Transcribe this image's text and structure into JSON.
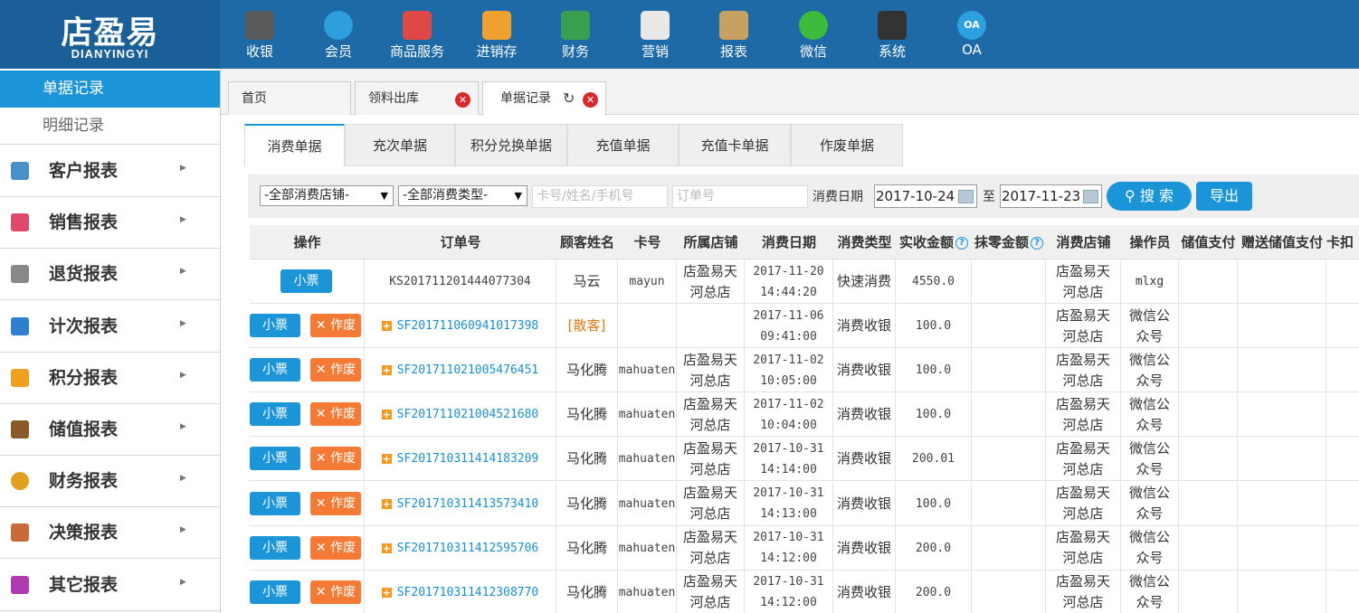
{
  "brand": {
    "name_cn": "店盈易",
    "name_en": "DIANYINGYI"
  },
  "topnav": [
    {
      "label": "收银",
      "icon": "cash-register-icon",
      "color": "#5a5a5a"
    },
    {
      "label": "会员",
      "icon": "member-icon",
      "color": "#2e9fdc"
    },
    {
      "label": "商品服务",
      "icon": "goods-icon",
      "color": "#e04848"
    },
    {
      "label": "进销存",
      "icon": "inventory-icon",
      "color": "#f0a030"
    },
    {
      "label": "财务",
      "icon": "finance-icon",
      "color": "#3aa050"
    },
    {
      "label": "营销",
      "icon": "megaphone-icon",
      "color": "#e8e8e8"
    },
    {
      "label": "报表",
      "icon": "report-icon",
      "color": "#c8a060"
    },
    {
      "label": "微信",
      "icon": "wechat-icon",
      "color": "#3cbb3c"
    },
    {
      "label": "系统",
      "icon": "monitor-icon",
      "color": "#333333"
    },
    {
      "label": "OA",
      "icon": "oa-icon",
      "color": "#2ea0e0"
    }
  ],
  "sidebar": {
    "sub_items": [
      "单据记录",
      "明细记录"
    ],
    "items": [
      {
        "label": "客户报表",
        "icon": "customer-icon"
      },
      {
        "label": "销售报表",
        "icon": "sales-icon"
      },
      {
        "label": "退货报表",
        "icon": "return-icon"
      },
      {
        "label": "计次报表",
        "icon": "count-icon"
      },
      {
        "label": "积分报表",
        "icon": "points-icon"
      },
      {
        "label": "储值报表",
        "icon": "wallet-icon"
      },
      {
        "label": "财务报表",
        "icon": "coin-icon"
      },
      {
        "label": "决策报表",
        "icon": "decision-icon"
      },
      {
        "label": "其它报表",
        "icon": "folder-icon"
      }
    ]
  },
  "tabs": [
    {
      "label": "首页"
    },
    {
      "label": "领料出库"
    },
    {
      "label": "单据记录"
    }
  ],
  "subtabs": [
    "消费单据",
    "充次单据",
    "积分兑换单据",
    "充值单据",
    "充值卡单据",
    "作废单据"
  ],
  "filters": {
    "store_select": "-全部消费店铺-",
    "type_select": "-全部消费类型-",
    "member_placeholder": "卡号/姓名/手机号",
    "order_placeholder": "订单号",
    "date_label": "消费日期",
    "date_from": "2017-10-24",
    "to_label": "至",
    "date_to": "2017-11-23",
    "search_label": "搜 索",
    "export_label": "导出"
  },
  "table": {
    "columns": [
      "操作",
      "订单号",
      "顾客姓名",
      "卡号",
      "所属店铺",
      "消费日期",
      "消费类型",
      "实收金额",
      "抹零金额",
      "消费店铺",
      "操作员",
      "储值支付",
      "赠送储值支付",
      "卡扣"
    ],
    "ticket_label": "小票",
    "void_label": "作废",
    "rows": [
      {
        "order": "KS201711201444077304",
        "name": "马云",
        "card": "mayun",
        "store": "店盈易天河总店",
        "date": "2017-11-20",
        "time": "14:44:20",
        "type": "快速消费",
        "amount": "4550.0",
        "shop": "店盈易天河总店",
        "operator": "mlxg",
        "voidable": false
      },
      {
        "order": "SF201711060941017398",
        "name": "[散客]",
        "card": "",
        "store": "",
        "date": "2017-11-06",
        "time": "09:41:00",
        "type": "消费收银",
        "amount": "100.0",
        "shop": "店盈易天河总店",
        "operator": "微信公众号",
        "voidable": true
      },
      {
        "order": "SF201711021005476451",
        "name": "马化腾",
        "card": "mahuaten",
        "store": "店盈易天河总店",
        "date": "2017-11-02",
        "time": "10:05:00",
        "type": "消费收银",
        "amount": "100.0",
        "shop": "店盈易天河总店",
        "operator": "微信公众号",
        "voidable": true
      },
      {
        "order": "SF201711021004521680",
        "name": "马化腾",
        "card": "mahuaten",
        "store": "店盈易天河总店",
        "date": "2017-11-02",
        "time": "10:04:00",
        "type": "消费收银",
        "amount": "100.0",
        "shop": "店盈易天河总店",
        "operator": "微信公众号",
        "voidable": true
      },
      {
        "order": "SF201710311414183209",
        "name": "马化腾",
        "card": "mahuaten",
        "store": "店盈易天河总店",
        "date": "2017-10-31",
        "time": "14:14:00",
        "type": "消费收银",
        "amount": "200.01",
        "shop": "店盈易天河总店",
        "operator": "微信公众号",
        "voidable": true
      },
      {
        "order": "SF201710311413573410",
        "name": "马化腾",
        "card": "mahuaten",
        "store": "店盈易天河总店",
        "date": "2017-10-31",
        "time": "14:13:00",
        "type": "消费收银",
        "amount": "100.0",
        "shop": "店盈易天河总店",
        "operator": "微信公众号",
        "voidable": true
      },
      {
        "order": "SF201710311412595706",
        "name": "马化腾",
        "card": "mahuaten",
        "store": "店盈易天河总店",
        "date": "2017-10-31",
        "time": "14:12:00",
        "type": "消费收银",
        "amount": "200.0",
        "shop": "店盈易天河总店",
        "operator": "微信公众号",
        "voidable": true
      },
      {
        "order": "SF201710311412308770",
        "name": "马化腾",
        "card": "mahuaten",
        "store": "店盈易天河总店",
        "date": "2017-10-31",
        "time": "14:12:00",
        "type": "消费收银",
        "amount": "200.0",
        "shop": "店盈易天河总店",
        "operator": "微信公众号",
        "voidable": true
      }
    ]
  }
}
